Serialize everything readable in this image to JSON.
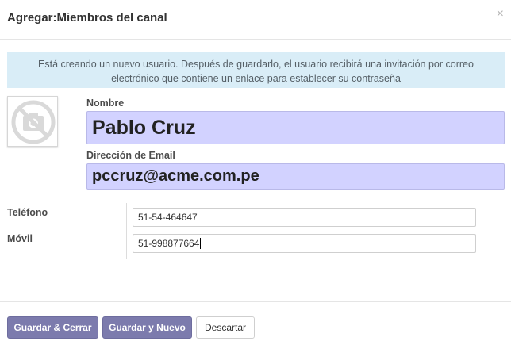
{
  "dialog": {
    "title": "Agregar:Miembros del canal",
    "close_glyph": "×"
  },
  "alert": {
    "text": "Está creando un nuevo usuario. Después de guardarlo, el usuario recibirá una invitación por correo electrónico que contiene un enlace para establecer su contraseña"
  },
  "avatar": {
    "icon": "no-photo-camera-icon"
  },
  "form": {
    "name_label": "Nombre",
    "name_value": "Pablo Cruz",
    "email_label": "Dirección de Email",
    "email_value": "pccruz@acme.com.pe",
    "phone_label": "Teléfono",
    "phone_value": "51-54-464647",
    "mobile_label": "Móvil",
    "mobile_value": "51-998877664"
  },
  "footer": {
    "save_close_label": "Guardar & Cerrar",
    "save_new_label": "Guardar y Nuevo",
    "discard_label": "Descartar"
  },
  "colors": {
    "accent": "#7c7bad",
    "required_field_bg": "#d2d2ff",
    "info_bg": "#d9edf7"
  }
}
